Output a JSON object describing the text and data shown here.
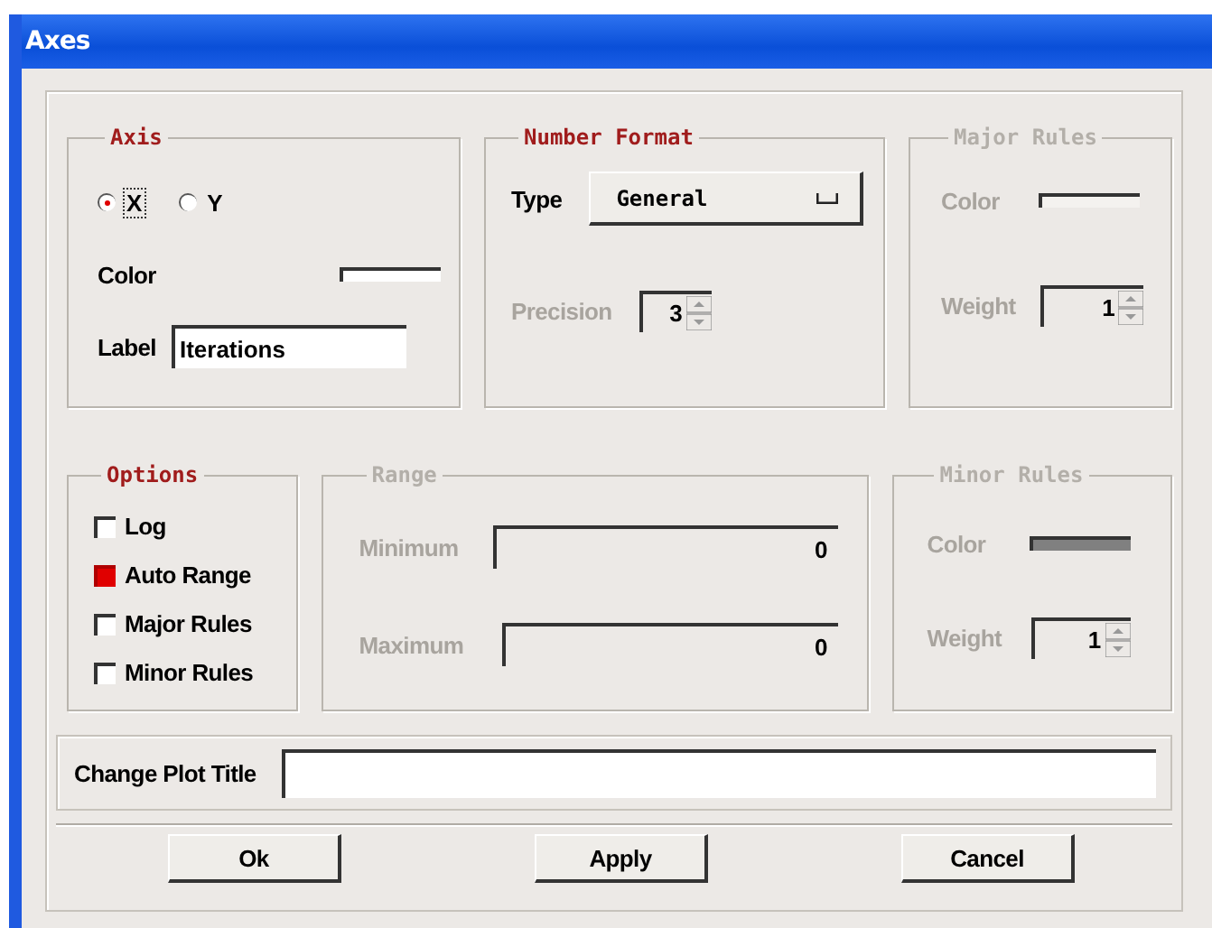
{
  "window": {
    "title": "Axes"
  },
  "axis": {
    "title": "Axis",
    "disabled": false,
    "choices": [
      {
        "label": "X",
        "selected": true
      },
      {
        "label": "Y",
        "selected": false
      }
    ],
    "color": {
      "label": "Color",
      "color": "#ffffff"
    },
    "label_field": {
      "label": "Label",
      "value": "Iterations"
    }
  },
  "number_format": {
    "title": "Number Format",
    "disabled": false,
    "type": {
      "label": "Type",
      "value": "General"
    },
    "precision": {
      "label": "Precision",
      "value": "3",
      "disabled": true
    }
  },
  "major_rules": {
    "title": "Major Rules",
    "disabled": true,
    "color": {
      "label": "Color",
      "color": "#f4f2ef"
    },
    "weight": {
      "label": "Weight",
      "value": "1"
    }
  },
  "options": {
    "title": "Options",
    "disabled": false,
    "checkboxes": [
      {
        "label": "Log",
        "checked": false
      },
      {
        "label": "Auto Range",
        "checked": true
      },
      {
        "label": "Major Rules",
        "checked": false
      },
      {
        "label": "Minor Rules",
        "checked": false
      }
    ]
  },
  "range": {
    "title": "Range",
    "disabled": true,
    "fields": [
      {
        "label": "Minimum",
        "value": "0"
      },
      {
        "label": "Maximum",
        "value": "0"
      }
    ]
  },
  "minor_rules": {
    "title": "Minor Rules",
    "disabled": true,
    "color": {
      "label": "Color",
      "color": "#808080"
    },
    "weight": {
      "label": "Weight",
      "value": "1"
    }
  },
  "plot_title": {
    "label": "Change Plot Title"
  },
  "buttons": [
    "Ok",
    "Apply",
    "Cancel"
  ]
}
